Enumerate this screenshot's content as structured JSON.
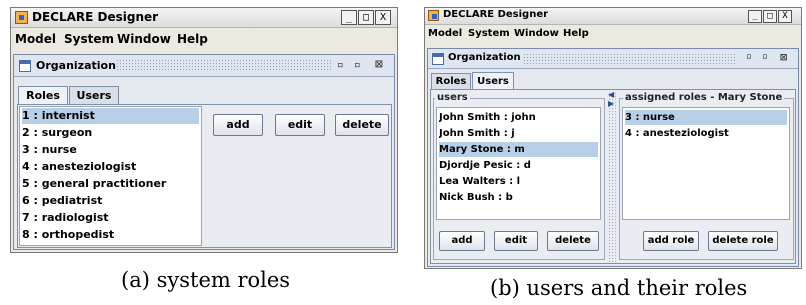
{
  "left": {
    "window_title": "DECLARE Designer",
    "window_buttons": [
      "_",
      "□",
      "X"
    ],
    "menu": [
      "Model",
      "System",
      "Window",
      "Help"
    ],
    "frame_title": "Organization",
    "frame_controls": [
      "▫",
      "▫",
      "⊠"
    ],
    "tabs": [
      "Roles",
      "Users"
    ],
    "selected_tab": "Roles",
    "roles": [
      "1 : internist",
      "2 : surgeon",
      "3 : nurse",
      "4 : anesteziologist",
      "5 : general practitioner",
      "6 : pediatrist",
      "7 : radiologist",
      "8 : orthopedist"
    ],
    "selected_role": "1 : internist",
    "buttons": {
      "add": "add",
      "edit": "edit",
      "delete": "delete"
    },
    "caption": "(a) system roles"
  },
  "right": {
    "window_title": "DECLARE Designer",
    "window_buttons": [
      "_",
      "□",
      "X"
    ],
    "menu": [
      "Model",
      "System",
      "Window",
      "Help"
    ],
    "frame_title": "Organization",
    "frame_controls": [
      "▫",
      "▫",
      "⊠"
    ],
    "tabs": [
      "Roles",
      "Users"
    ],
    "selected_tab": "Users",
    "users_label": "users",
    "users": [
      "John Smith : john",
      "John Smith : j",
      "Mary Stone : m",
      "Djordje Pesic : d",
      "Lea Walters : l",
      "Nick Bush : b"
    ],
    "selected_user": "Mary Stone : m",
    "user_buttons": {
      "add": "add",
      "edit": "edit",
      "delete": "delete"
    },
    "assigned_label": "assigned roles - Mary Stone",
    "assigned_roles": [
      "3 : nurse",
      "4 : anesteziologist"
    ],
    "selected_assigned": "3 : nurse",
    "role_buttons": {
      "add_role": "add role",
      "delete_role": "delete role"
    },
    "caption": "(b) users and their roles"
  }
}
